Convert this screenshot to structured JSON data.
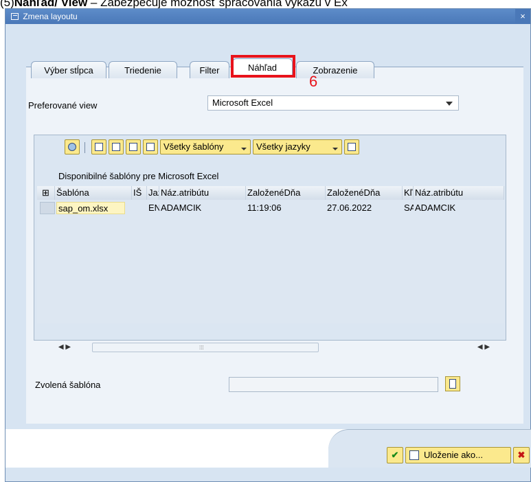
{
  "caption": {
    "prefix": "(5)",
    "bold": "Náhľad/ View",
    "rest": " – Zabezpečuje možnosť spracovania výkazu v Ex"
  },
  "window": {
    "title": "Zmena layoutu",
    "close": "×"
  },
  "tabs": [
    {
      "label": "Výber stĺpca"
    },
    {
      "label": "Triedenie"
    },
    {
      "label": "Filter"
    },
    {
      "label": "Náhľad"
    },
    {
      "label": "Zobrazenie"
    }
  ],
  "annotation": {
    "step": "6"
  },
  "preferred_view": {
    "label": "Preferované view",
    "value": "Microsoft Excel"
  },
  "toolbar": {
    "templates_label": "Všetky šablóny",
    "languages_label": "Všetky jazyky"
  },
  "templates": {
    "title": "Disponibilné šablóny pre Microsoft Excel",
    "columns": [
      "Šablóna",
      "IŠ",
      "Jazyk",
      "Náz.atribútu",
      "ZaloženéDňa",
      "ZaloženéDňa",
      "Kľ",
      "Náz.atribútu"
    ],
    "rows": [
      [
        "sap_om.xlsx",
        "",
        "EN",
        "ADAMCIK",
        "11:19:06",
        "27.06.2022",
        "SA",
        "ADAMCIK"
      ]
    ]
  },
  "chosen_template": {
    "label": "Zvolená šablóna",
    "value": ""
  },
  "footer": {
    "ok": "✔",
    "save_as": "Uloženie ako...",
    "cancel": "✖"
  }
}
